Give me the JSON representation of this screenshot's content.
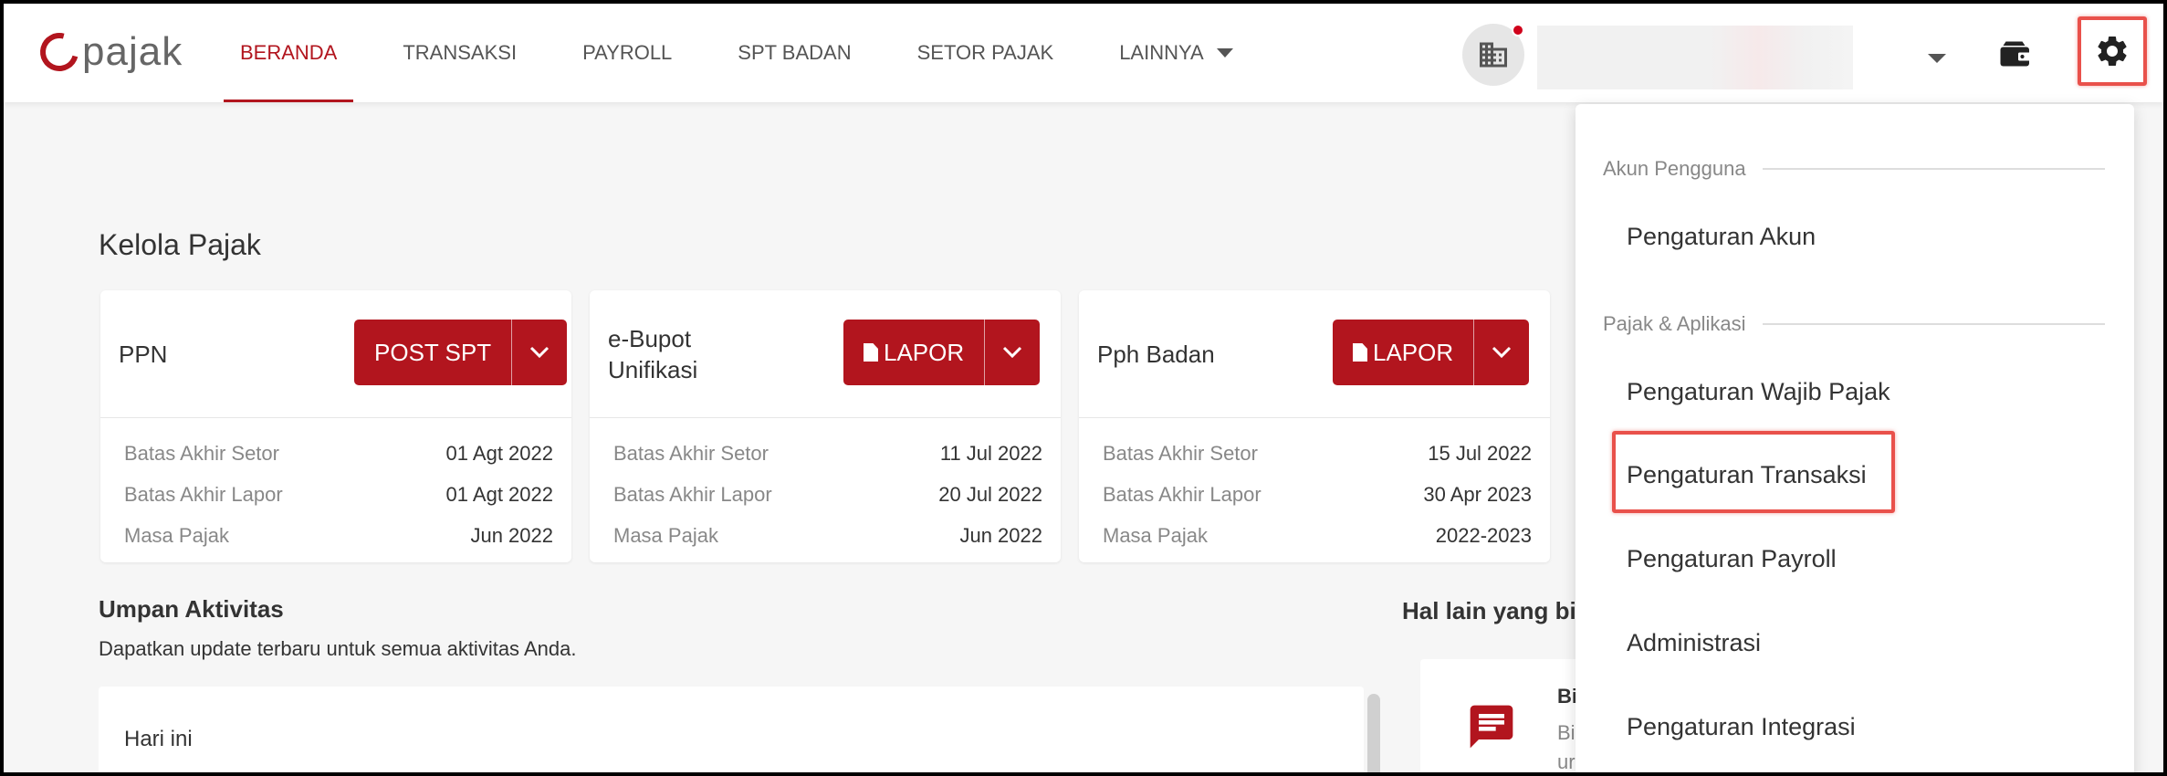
{
  "brand": {
    "logo_text": "pajak",
    "accent_color": "#b2151e",
    "highlight_color": "#e9514b"
  },
  "nav": {
    "items": [
      {
        "label": "BERANDA",
        "active": true
      },
      {
        "label": "TRANSAKSI",
        "active": false
      },
      {
        "label": "PAYROLL",
        "active": false
      },
      {
        "label": "SPT BADAN",
        "active": false
      },
      {
        "label": "SETOR PAJAK",
        "active": false
      },
      {
        "label": "LAINNYA",
        "active": false,
        "has_dropdown": true
      }
    ]
  },
  "header": {
    "icons": [
      "building-icon",
      "caret-down-icon",
      "wallet-icon",
      "gear-icon"
    ],
    "notification": true
  },
  "main": {
    "section_title": "Kelola Pajak",
    "cards": [
      {
        "name": "PPN",
        "button_label": "POST SPT",
        "button_icon": false,
        "rows": [
          {
            "label": "Batas Akhir Setor",
            "value": "01 Agt 2022"
          },
          {
            "label": "Batas Akhir Lapor",
            "value": "01 Agt 2022"
          },
          {
            "label": "Masa Pajak",
            "value": "Jun 2022"
          }
        ]
      },
      {
        "name": "e-Bupot Unifikasi",
        "button_label": "LAPOR",
        "button_icon": true,
        "rows": [
          {
            "label": "Batas Akhir Setor",
            "value": "11 Jul 2022"
          },
          {
            "label": "Batas Akhir Lapor",
            "value": "20 Jul 2022"
          },
          {
            "label": "Masa Pajak",
            "value": "Jun 2022"
          }
        ]
      },
      {
        "name": "Pph Badan",
        "button_label": "LAPOR",
        "button_icon": true,
        "rows": [
          {
            "label": "Batas Akhir Setor",
            "value": "15 Jul 2022"
          },
          {
            "label": "Batas Akhir Lapor",
            "value": "30 Apr 2023"
          },
          {
            "label": "Masa Pajak",
            "value": "2022-2023"
          }
        ]
      }
    ],
    "feed": {
      "title": "Umpan Aktivitas",
      "subtitle": "Dapatkan update terbaru untuk semua aktivitas Anda.",
      "day_label": "Hari ini"
    },
    "other": {
      "title": "Hal lain yang bis",
      "line1": "Bi",
      "line2": "Bi",
      "line3": "ur"
    }
  },
  "dropdown": {
    "sections": [
      {
        "title": "Akun Pengguna",
        "items": [
          "Pengaturan Akun"
        ]
      },
      {
        "title": "Pajak & Aplikasi",
        "items": [
          "Pengaturan Wajib Pajak",
          "Pengaturan Transaksi",
          "Pengaturan Payroll",
          "Administrasi",
          "Pengaturan Integrasi"
        ]
      }
    ],
    "highlighted_item": "Pengaturan Transaksi"
  }
}
